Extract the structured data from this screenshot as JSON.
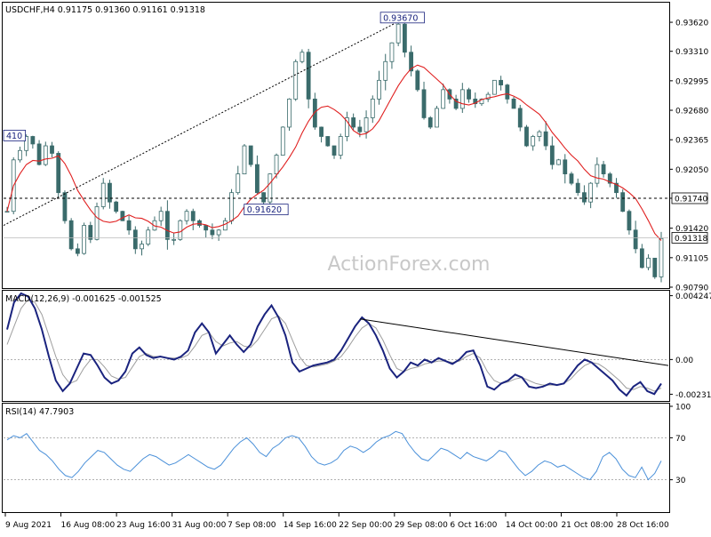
{
  "chart_data": [
    {
      "panel": "price",
      "type": "bar",
      "symbol_line": "USDCHF,H4  0.91175 0.91360 0.91161 0.91318",
      "watermark": "ActionForex.com",
      "ylim": [
        0.9079,
        0.9382
      ],
      "yticks": [
        "0.93620",
        "0.93310",
        "0.92995",
        "0.92680",
        "0.92365",
        "0.92050",
        "0.91740",
        "0.91420",
        "0.91105",
        "0.90790"
      ],
      "price_tag_current": "0.91318",
      "current_price": 0.91318,
      "price_tag_level": "0.91740",
      "level_value": 0.9174,
      "annotations": [
        {
          "text": "0.93670",
          "value": 0.9367
        },
        {
          "text": "0.91620",
          "value": 0.9162
        },
        {
          "text": "410",
          "value": 0.9241
        }
      ],
      "trendline": {
        "from": [
          0.0,
          0.9145
        ],
        "to": [
          0.6,
          0.9365
        ]
      },
      "closes": [
        0.916,
        0.9215,
        0.9225,
        0.924,
        0.9232,
        0.921,
        0.923,
        0.9222,
        0.918,
        0.915,
        0.912,
        0.9115,
        0.9145,
        0.913,
        0.9165,
        0.919,
        0.917,
        0.916,
        0.915,
        0.914,
        0.912,
        0.9125,
        0.914,
        0.915,
        0.916,
        0.913,
        0.913,
        0.915,
        0.916,
        0.915,
        0.9145,
        0.914,
        0.9135,
        0.914,
        0.915,
        0.918,
        0.92,
        0.923,
        0.921,
        0.918,
        0.917,
        0.92,
        0.922,
        0.925,
        0.928,
        0.932,
        0.933,
        0.928,
        0.925,
        0.924,
        0.923,
        0.922,
        0.924,
        0.926,
        0.925,
        0.9245,
        0.926,
        0.928,
        0.93,
        0.932,
        0.934,
        0.936,
        0.933,
        0.931,
        0.929,
        0.926,
        0.925,
        0.927,
        0.929,
        0.928,
        0.927,
        0.929,
        0.928,
        0.9275,
        0.928,
        0.9285,
        0.93,
        0.9295,
        0.928,
        0.927,
        0.925,
        0.923,
        0.924,
        0.9245,
        0.923,
        0.921,
        0.9215,
        0.92,
        0.919,
        0.918,
        0.917,
        0.919,
        0.921,
        0.92,
        0.919,
        0.918,
        0.916,
        0.914,
        0.912,
        0.91,
        0.911,
        0.909,
        0.9131
      ]
    },
    {
      "panel": "macd",
      "type": "line",
      "label": "MACD(12,26,9) -0.001625 -0.001525",
      "ylim": [
        -0.0027,
        0.0044
      ],
      "yticks": [
        "0.004247",
        "0.00",
        "-0.002311"
      ],
      "zero_tag": "0.00",
      "trendline": {
        "from": [
          0.536,
          0.0027
        ],
        "to": [
          1.0,
          -0.0004
        ]
      },
      "series": [
        {
          "name": "MACD",
          "color": "#1a237e",
          "values": [
            0.002,
            0.0038,
            0.0044,
            0.0042,
            0.0034,
            0.002,
            0.0002,
            -0.0014,
            -0.0021,
            -0.0016,
            -0.0006,
            0.0004,
            0.0003,
            -0.0004,
            -0.0012,
            -0.0016,
            -0.0014,
            -0.0008,
            0.0004,
            0.0008,
            0.0003,
            0.0001,
            0.0002,
            0.0001,
            0.0,
            0.0002,
            0.0006,
            0.0018,
            0.0024,
            0.0018,
            0.0004,
            0.001,
            0.0016,
            0.001,
            0.0005,
            0.001,
            0.0022,
            0.003,
            0.0036,
            0.0028,
            0.0016,
            -0.0002,
            -0.0008,
            -0.0006,
            -0.0004,
            -0.0003,
            -0.0002,
            0.0,
            0.0006,
            0.0014,
            0.0022,
            0.0028,
            0.0024,
            0.0016,
            0.0006,
            -0.0006,
            -0.0012,
            -0.0008,
            -0.0002,
            -0.0004,
            0.0,
            -0.0002,
            0.0001,
            -0.0001,
            -0.0003,
            0.0,
            0.0005,
            0.0006,
            -0.0004,
            -0.0018,
            -0.002,
            -0.0016,
            -0.0014,
            -0.001,
            -0.0012,
            -0.0018,
            -0.0019,
            -0.0018,
            -0.0016,
            -0.0017,
            -0.0016,
            -0.001,
            -0.0004,
            0.0,
            -0.0002,
            -0.0006,
            -0.001,
            -0.0014,
            -0.002,
            -0.0024,
            -0.0018,
            -0.0015,
            -0.0021,
            -0.0023,
            -0.0016
          ]
        },
        {
          "name": "Signal",
          "color": "#9e9e9e",
          "values": [
            0.001,
            0.0022,
            0.0034,
            0.004,
            0.0038,
            0.003,
            0.0016,
            0.0002,
            -0.001,
            -0.0016,
            -0.0014,
            -0.0006,
            0.0,
            0.0,
            -0.0005,
            -0.0011,
            -0.0013,
            -0.0012,
            -0.0005,
            0.0002,
            0.0004,
            0.0002,
            0.0002,
            0.0001,
            0.0001,
            0.0001,
            0.0003,
            0.0009,
            0.0016,
            0.0018,
            0.0012,
            0.0009,
            0.0011,
            0.0012,
            0.0009,
            0.0008,
            0.0013,
            0.002,
            0.0027,
            0.0029,
            0.0024,
            0.0013,
            0.0002,
            -0.0004,
            -0.0005,
            -0.0004,
            -0.0003,
            -0.0001,
            0.0002,
            0.0008,
            0.0015,
            0.0021,
            0.0024,
            0.0021,
            0.0013,
            0.0003,
            -0.0006,
            -0.0008,
            -0.0006,
            -0.0005,
            -0.0003,
            -0.0002,
            -0.0001,
            -0.0001,
            -0.0002,
            -0.0001,
            0.0002,
            0.0004,
            0.0001,
            -0.0008,
            -0.0014,
            -0.0016,
            -0.0015,
            -0.0013,
            -0.0012,
            -0.0014,
            -0.0016,
            -0.0017,
            -0.0017,
            -0.0017,
            -0.0016,
            -0.0013,
            -0.0008,
            -0.0004,
            -0.0002,
            -0.0003,
            -0.0006,
            -0.001,
            -0.0014,
            -0.0019,
            -0.002,
            -0.0018,
            -0.0019,
            -0.0021,
            -0.0019
          ]
        }
      ]
    },
    {
      "panel": "rsi",
      "type": "line",
      "label": "RSI(14) 47.7903",
      "ylim": [
        0,
        100
      ],
      "yticks": [
        "100",
        "70",
        "30"
      ],
      "levels": [
        70,
        30
      ],
      "series": [
        {
          "name": "RSI",
          "color": "#4a90d9",
          "values": [
            68,
            72,
            70,
            74,
            66,
            58,
            54,
            48,
            40,
            34,
            32,
            38,
            46,
            52,
            58,
            56,
            50,
            44,
            40,
            38,
            44,
            50,
            54,
            52,
            48,
            44,
            46,
            50,
            54,
            50,
            46,
            42,
            40,
            44,
            52,
            60,
            66,
            70,
            64,
            56,
            52,
            60,
            64,
            70,
            72,
            70,
            62,
            52,
            46,
            44,
            46,
            50,
            58,
            62,
            60,
            56,
            60,
            66,
            70,
            72,
            76,
            74,
            64,
            56,
            50,
            48,
            54,
            60,
            58,
            54,
            50,
            56,
            52,
            50,
            48,
            52,
            58,
            56,
            48,
            40,
            34,
            38,
            44,
            48,
            46,
            42,
            44,
            40,
            36,
            32,
            30,
            38,
            52,
            56,
            50,
            40,
            34,
            32,
            42,
            30,
            36,
            48
          ]
        }
      ]
    },
    {
      "panel": "x-axis",
      "type": "table",
      "categories": [
        "9 Aug 2021",
        "16 Aug 08:00",
        "23 Aug 16:00",
        "31 Aug 00:00",
        "7 Sep 08:00",
        "14 Sep 16:00",
        "22 Sep 00:00",
        "29 Sep 08:00",
        "6 Oct 16:00",
        "14 Oct 00:00",
        "21 Oct 08:00",
        "28 Oct 16:00"
      ]
    }
  ]
}
